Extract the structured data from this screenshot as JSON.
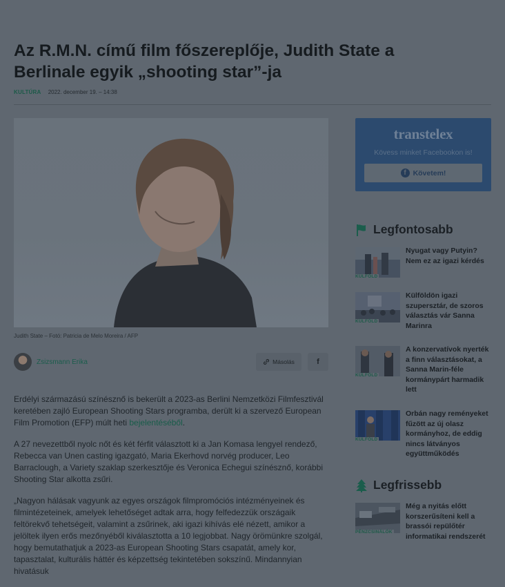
{
  "article": {
    "title": "Az R.M.N. című film főszereplője, Judith State a Berlinale egyik „shooting star”-ja",
    "category": "KULTÚRA",
    "date": "2022. december 19. – 14:38",
    "image_caption": "Judith State – Fotó: Patricia de Melo Moreira / AFP",
    "author": "Zsizsmann Erika",
    "copy_label": "Másolás",
    "share_icon_glyph": "f",
    "paragraphs": [
      {
        "text": "Erdélyi származású színésznő is bekerült a 2023-as Berlini Nemzetközi Filmfesztivál keretében zajló European Shooting Stars programba, derült ki a szervező European Film Promotion (EFP) múlt heti ",
        "link": "bejelentéséből",
        "after": "."
      },
      {
        "text": "A 27 nevezettből nyolc nőt és két férfit választott ki a Jan Komasa lengyel rendező, Rebecca van Unen casting igazgató, Maria Ekerhovd norvég producer, Leo Barraclough, a Variety szaklap szerkesztője és Veronica Echegui színésznő, korábbi Shooting Star alkotta zsűri."
      },
      {
        "text": "„Nagyon hálásak vagyunk az egyes országok filmpromóciós intézményeinek és filmintézeteinek, amelyek lehetőséget adtak arra, hogy felfedezzük országaik feltörekvő tehetségeit, valamint a zsűrinek, aki igazi kihívás elé nézett, amikor a jelöltek ilyen erős mezőnyéből kiválasztotta a 10 legjobbat. Nagy örömünkre szolgál, hogy bemutathatjuk a 2023-as European Shooting Stars csapatát, amely kor, tapasztalat, kulturális háttér és képzettség tekintetében sokszínű. Mindannyian hivatásuk"
      }
    ]
  },
  "sidebar": {
    "promo": {
      "logo": "transtelex",
      "subtitle": "Kövess minket Facebookon is!",
      "button": "Követem!"
    },
    "top": {
      "title": "Legfontosabb",
      "items": [
        {
          "tag": "KÜLFÖLD",
          "title": "Nyugat vagy Putyin? Nem ez az igazi kérdés"
        },
        {
          "tag": "KÜLFÖLD",
          "title": "Külföldön igazi szupersztár, de szoros választás vár Sanna Marinra"
        },
        {
          "tag": "KÜLFÖLD",
          "title": "A konzervatívok nyerték a finn választásokat, a Sanna Marin-féle kormánypárt harmadik lett"
        },
        {
          "tag": "KÜLFÖLD",
          "title": "Orbán nagy reményeket fűzött az új olasz kormányhoz, de eddig nincs látványos együttműködés"
        }
      ]
    },
    "latest": {
      "title": "Legfrissebb",
      "items": [
        {
          "tag": "PÉNZCSINÁLÓK",
          "title": "Még a nyitás előtt korszerűsíteni kell a brassói repülőtér informatikai rendszerét"
        }
      ]
    }
  },
  "colors": {
    "overlay_bg": "#5f6770",
    "accent_green": "#1b5d4c",
    "promo_blue": "#2c4a6e"
  }
}
